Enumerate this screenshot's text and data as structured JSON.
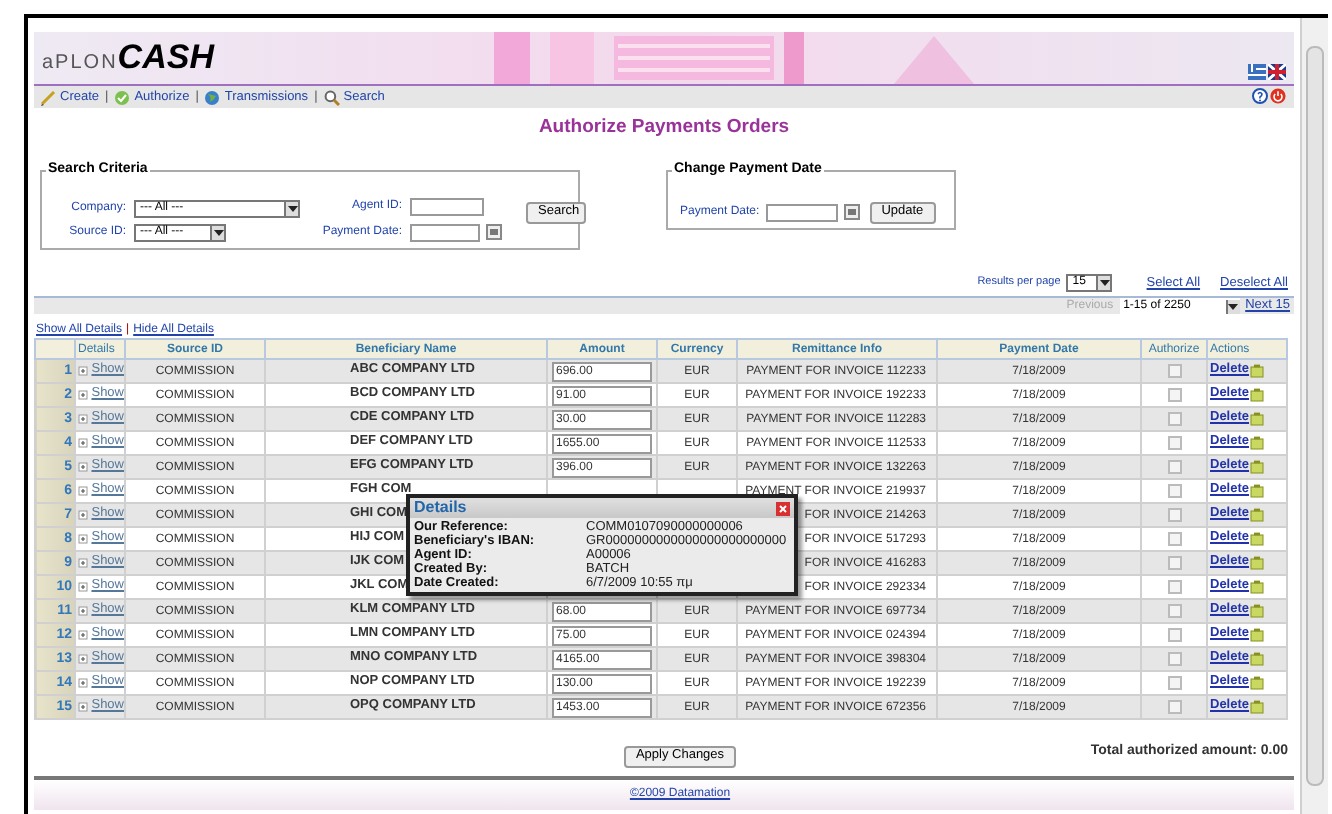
{
  "header": {
    "logo_prefix": "aPLON",
    "logo_brand": "CASH"
  },
  "nav": [
    {
      "label": "Create"
    },
    {
      "label": "Authorize"
    },
    {
      "label": "Transmissions"
    },
    {
      "label": "Search"
    }
  ],
  "nav_separators": [
    "|",
    "|",
    "|"
  ],
  "title": "Authorize Payments Orders",
  "search_criteria": {
    "legend": "Search Criteria",
    "company": {
      "label": "Company:",
      "value": "--- All ---"
    },
    "source_id": {
      "label": "Source ID:",
      "value": "--- All ---"
    },
    "agent_id": {
      "label": "Agent ID:"
    },
    "payment_date": {
      "label": "Payment Date:"
    },
    "button": "Search"
  },
  "change_payment_date": {
    "legend": "Change Payment Date",
    "payment_date": {
      "label": "Payment Date:"
    },
    "button": "Update"
  },
  "results_per_page": {
    "label": "Results per page",
    "value": "15"
  },
  "select_all": "Select All",
  "deselect_all": "Deselect All",
  "pager": {
    "previous": "Previous",
    "range": "1-15 of 2250",
    "next": "Next 15"
  },
  "show_all": "Show All Details",
  "links_separator": "|",
  "hide_all": "Hide All Details",
  "table": {
    "columns": [
      "Details",
      "Source ID",
      "Beneficiary Name",
      "Amount",
      "Currency",
      "Remittance Info",
      "Payment Date",
      "Authorize",
      "Actions"
    ],
    "rows": [
      {
        "number": "1",
        "details": "Show",
        "source_id": "COMMISSION",
        "beneficiary": "ABC COMPANY LTD",
        "amount": "696.00",
        "currency": "EUR",
        "remittance": "PAYMENT FOR INVOICE 112233",
        "payment_date": "7/18/2009",
        "authorized": false,
        "action": "Delete"
      },
      {
        "number": "2",
        "details": "Show",
        "source_id": "COMMISSION",
        "beneficiary": "BCD COMPANY LTD",
        "amount": "91.00",
        "currency": "EUR",
        "remittance": "PAYMENT FOR INVOICE 192233",
        "payment_date": "7/18/2009",
        "authorized": false,
        "action": "Delete"
      },
      {
        "number": "3",
        "details": "Show",
        "source_id": "COMMISSION",
        "beneficiary": "CDE COMPANY LTD",
        "amount": "30.00",
        "currency": "EUR",
        "remittance": "PAYMENT FOR INVOICE 112283",
        "payment_date": "7/18/2009",
        "authorized": false,
        "action": "Delete"
      },
      {
        "number": "4",
        "details": "Show",
        "source_id": "COMMISSION",
        "beneficiary": "DEF COMPANY LTD",
        "amount": "1655.00",
        "currency": "EUR",
        "remittance": "PAYMENT FOR INVOICE 112533",
        "payment_date": "7/18/2009",
        "authorized": false,
        "action": "Delete"
      },
      {
        "number": "5",
        "details": "Show",
        "source_id": "COMMISSION",
        "beneficiary": "EFG COMPANY LTD",
        "amount": "396.00",
        "currency": "EUR",
        "remittance": "PAYMENT FOR INVOICE 132263",
        "payment_date": "7/18/2009",
        "authorized": false,
        "action": "Delete"
      },
      {
        "number": "6",
        "details": "Show",
        "source_id": "COMMISSION",
        "beneficiary": "FGH COM",
        "remittance": "PAYMENT FOR INVOICE 219937",
        "payment_date": "7/18/2009",
        "authorized": false,
        "action": "Delete"
      },
      {
        "number": "7",
        "details": "Show",
        "source_id": "COMMISSION",
        "beneficiary": "GHI COM",
        "remittance": "FOR INVOICE 214263",
        "payment_date": "7/18/2009",
        "authorized": false,
        "action": "Delete"
      },
      {
        "number": "8",
        "details": "Show",
        "source_id": "COMMISSION",
        "beneficiary": "HIJ COM",
        "remittance": "FOR INVOICE 517293",
        "payment_date": "7/18/2009",
        "authorized": false,
        "action": "Delete"
      },
      {
        "number": "9",
        "details": "Show",
        "source_id": "COMMISSION",
        "beneficiary": "IJK COM",
        "remittance": "FOR INVOICE 416283",
        "payment_date": "7/18/2009",
        "authorized": false,
        "action": "Delete"
      },
      {
        "number": "10",
        "details": "Show",
        "source_id": "COMMISSION",
        "beneficiary": "JKL COM",
        "remittance": "FOR INVOICE 292334",
        "payment_date": "7/18/2009",
        "authorized": false,
        "action": "Delete"
      },
      {
        "number": "11",
        "details": "Show",
        "source_id": "COMMISSION",
        "beneficiary": "KLM COMPANY LTD",
        "amount": "68.00",
        "currency": "EUR",
        "remittance": "PAYMENT FOR INVOICE 697734",
        "payment_date": "7/18/2009",
        "authorized": false,
        "action": "Delete"
      },
      {
        "number": "12",
        "details": "Show",
        "source_id": "COMMISSION",
        "beneficiary": "LMN COMPANY LTD",
        "amount": "75.00",
        "currency": "EUR",
        "remittance": "PAYMENT FOR INVOICE 024394",
        "payment_date": "7/18/2009",
        "authorized": false,
        "action": "Delete"
      },
      {
        "number": "13",
        "details": "Show",
        "source_id": "COMMISSION",
        "beneficiary": "MNO COMPANY LTD",
        "amount": "4165.00",
        "currency": "EUR",
        "remittance": "PAYMENT FOR INVOICE 398304",
        "payment_date": "7/18/2009",
        "authorized": false,
        "action": "Delete"
      },
      {
        "number": "14",
        "details": "Show",
        "source_id": "COMMISSION",
        "beneficiary": "NOP COMPANY LTD",
        "amount": "130.00",
        "currency": "EUR",
        "remittance": "PAYMENT FOR INVOICE 192239",
        "payment_date": "7/18/2009",
        "authorized": false,
        "action": "Delete"
      },
      {
        "number": "15",
        "details": "Show",
        "source_id": "COMMISSION",
        "beneficiary": "OPQ COMPANY LTD",
        "amount": "1453.00",
        "currency": "EUR",
        "remittance": "PAYMENT FOR INVOICE 672356",
        "payment_date": "7/18/2009",
        "authorized": false,
        "action": "Delete"
      }
    ]
  },
  "details_popup": {
    "title": "Details",
    "fields": [
      {
        "label": "Our Reference:",
        "value": "COMM0107090000000006"
      },
      {
        "label": "Beneficiary's IBAN:",
        "value": "GR0000000000000000000000000"
      },
      {
        "label": "Agent ID:",
        "value": "A00006"
      },
      {
        "label": "Created By:",
        "value": "BATCH"
      },
      {
        "label": "Date Created:",
        "value": "6/7/2009 10:55 πμ"
      }
    ]
  },
  "total": "Total authorized amount: 0.00",
  "apply_button": "Apply Changes",
  "footer": "©2009 Datamation"
}
